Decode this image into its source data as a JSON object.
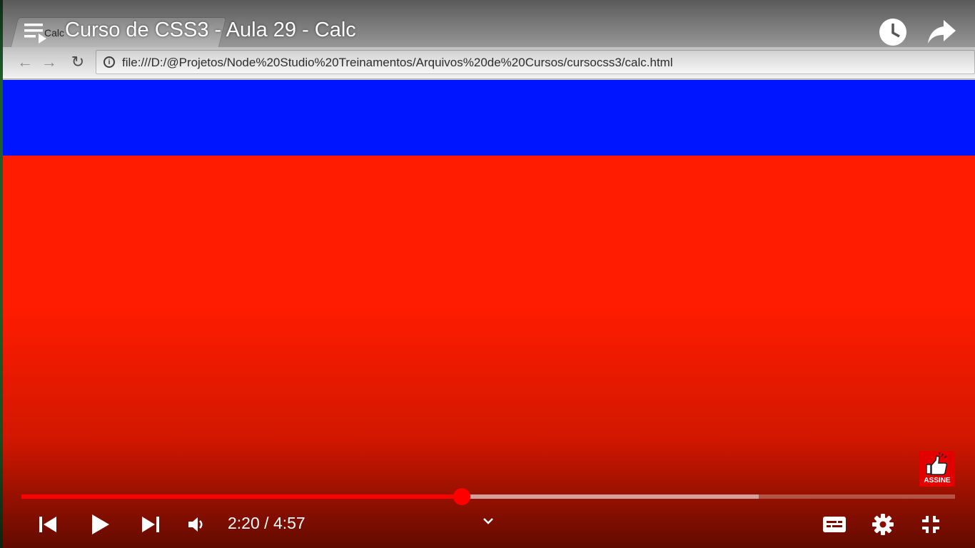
{
  "browser": {
    "tab_label": "Calc",
    "url": "file:///D:/@Projetos/Node%20Studio%20Treinamentos/Arquivos%20de%20Cursos/cursocss3/calc.html"
  },
  "page": {
    "band_color": "#0015ff",
    "background_color": "#ff1c00"
  },
  "player": {
    "title": "Curso de CSS3 - Aula 29 - Calc",
    "current_time": "2:20",
    "separator": "/",
    "duration": "4:57",
    "progress_fraction": 0.4714,
    "buffered_fraction": 0.79,
    "subscribe_label": "ASSINE",
    "accent_color": "#ff0000",
    "icons": {
      "playlist": "playlist-icon",
      "watch_later": "clock-icon",
      "share": "share-icon",
      "prev": "previous-icon",
      "play": "play-icon",
      "next": "next-icon",
      "volume": "volume-icon",
      "more": "chevron-down-icon",
      "captions": "captions-icon",
      "settings": "gear-icon",
      "fullscreen": "exit-fullscreen-icon"
    }
  }
}
